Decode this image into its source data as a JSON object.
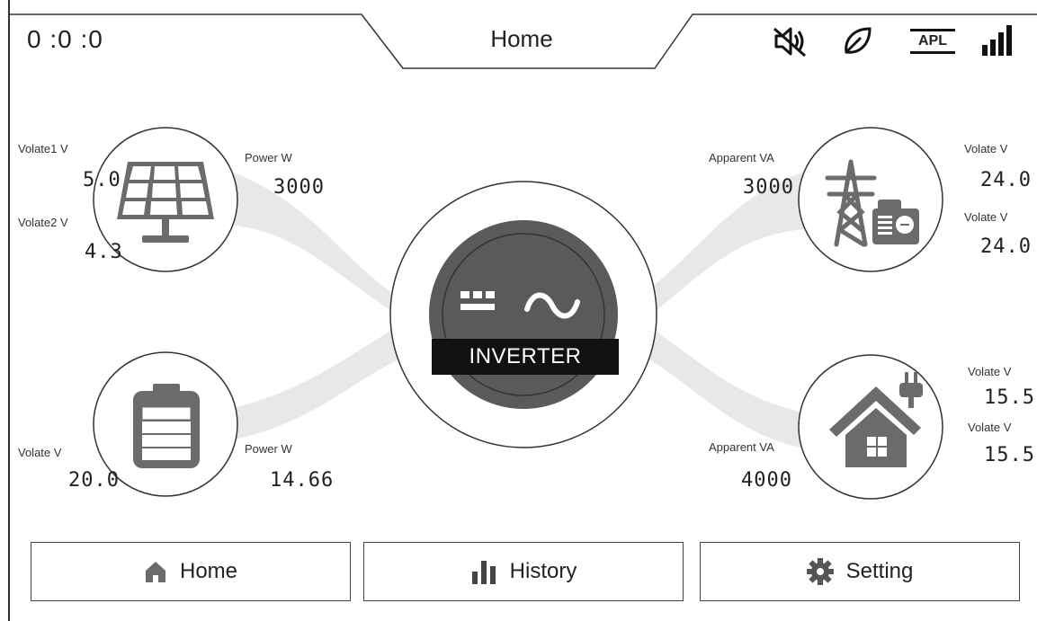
{
  "header": {
    "clock": "0 :0 :0",
    "title": "Home",
    "icons": [
      "mute-icon",
      "eco-leaf-icon",
      "apl-icon",
      "signal-icon"
    ],
    "apl_text": "APL"
  },
  "pv": {
    "volt1_label": "Volate1 V",
    "volt1_value": "5.0",
    "volt2_label": "Volate2 V",
    "volt2_value": "4.3",
    "power_label": "Power W",
    "power_value": "3000"
  },
  "battery": {
    "volt_label": "Volate V",
    "volt_value": "20.0",
    "power_label": "Power W",
    "power_value": "14.66"
  },
  "grid": {
    "apparent_label": "Apparent VA",
    "apparent_value": "3000",
    "volt1_label": "Volate V",
    "volt1_value": "24.0",
    "volt2_label": "Volate V",
    "volt2_value": "24.0"
  },
  "load": {
    "apparent_label": "Apparent VA",
    "apparent_value": "4000",
    "volt1_label": "Volate V",
    "volt1_value": "15.5",
    "volt2_label": "Volate V",
    "volt2_value": "15.5"
  },
  "inverter": {
    "label": "INVERTER"
  },
  "nav": {
    "home_label": "Home",
    "history_label": "History",
    "setting_label": "Setting"
  },
  "colors": {
    "icon_gray": "#6b6b6b",
    "flow_gray": "#e6e6e6",
    "inverter_dark": "#5a5a5a"
  }
}
